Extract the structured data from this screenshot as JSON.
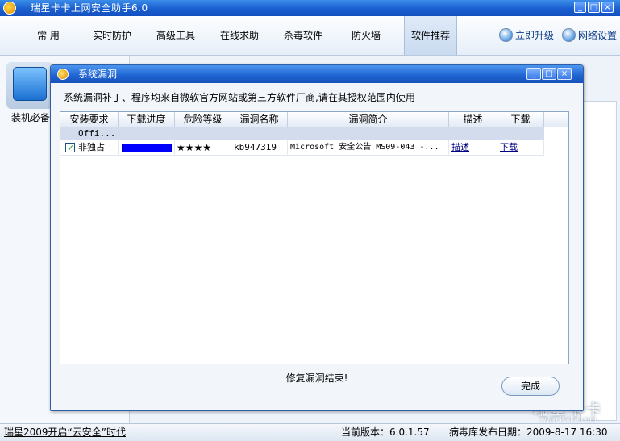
{
  "app": {
    "title": "瑞星卡卡上网安全助手6.0",
    "colors": {
      "title_bar": "#1a5fd0",
      "accent": "#2e6ee6"
    }
  },
  "window_buttons": [
    "_",
    "□",
    "×"
  ],
  "tabs": [
    {
      "label": "常 用"
    },
    {
      "label": "实时防护"
    },
    {
      "label": "高级工具"
    },
    {
      "label": "在线求助"
    },
    {
      "label": "杀毒软件"
    },
    {
      "label": "防火墙"
    },
    {
      "label": "软件推荐",
      "active": true
    }
  ],
  "header_links": {
    "upgrade": "立即升级",
    "network_settings": "网络设置"
  },
  "left_pane": {
    "item_label": "装机必备"
  },
  "status": {
    "left": "瑞星2009开启“云安全”时代",
    "version": "当前版本：6.0.1.57",
    "virus_db": "病毒库发布日期：2009-8-17 16:30"
  },
  "watermark": {
    "brand": "瑞星卡卡",
    "url": "www.ikaka.com"
  },
  "dialog": {
    "title": "系统漏洞",
    "buttons": [
      "_",
      "□",
      "×"
    ],
    "description": "系统漏洞补丁、程序均来自微软官方网站或第三方软件厂商,请在其授权范围内使用",
    "table": {
      "columns": [
        "安装要求",
        "下载进度",
        "危险等级",
        "漏洞名称",
        "漏洞简介",
        "描述",
        "下载"
      ],
      "group": "Offi...",
      "rows": [
        {
          "checked": true,
          "requirement": "非独占",
          "progress": 1.0,
          "risk": "★★★★",
          "name": "kb947319",
          "summary": "Microsoft 安全公告 MS09-043 -...",
          "describe": "描述",
          "download": "下载"
        }
      ]
    },
    "status_text": "修复漏洞结束!",
    "done_label": "完成"
  }
}
